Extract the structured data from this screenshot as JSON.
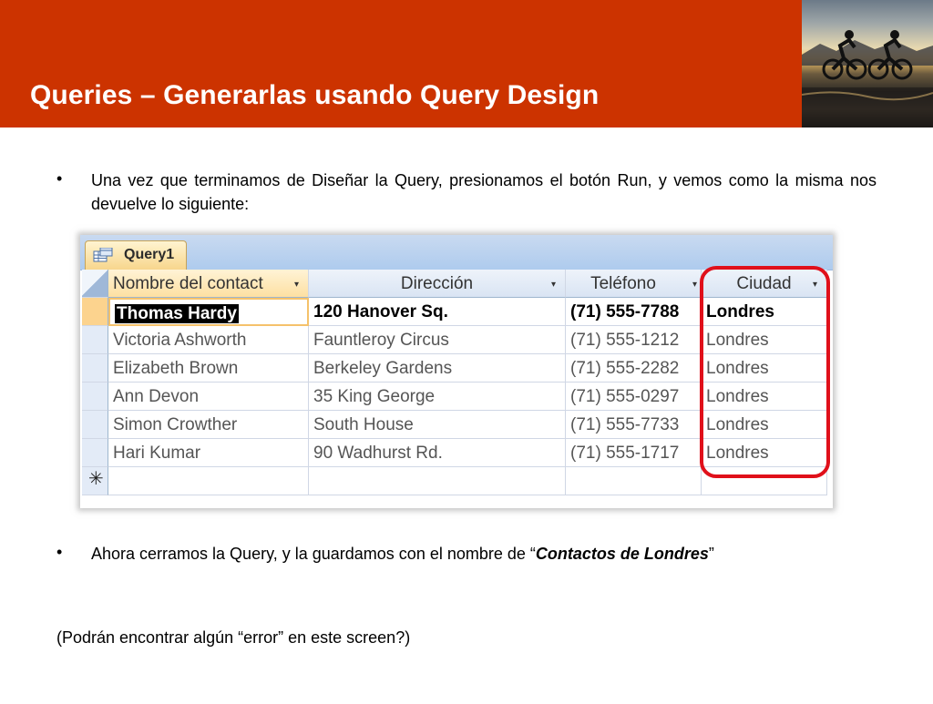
{
  "slide": {
    "title": "Queries – Generarlas usando Query Design",
    "bullet_symbol": "•",
    "bullet1": "Una vez que terminamos de Diseñar la Query, presionamos el botón Run, y vemos como la misma nos devuelve lo siguiente:",
    "bullet2_pre": "Ahora cerramos la Query, y la guardamos con el nombre de “",
    "bullet2_em": "Contactos de Londres",
    "bullet2_post": "”",
    "note": "(Podrán encontrar algún “error” en este screen?)"
  },
  "datasheet": {
    "tab_label": "Query1",
    "columns": [
      "Nombre del contact",
      "Dirección",
      "Teléfono",
      "Ciudad"
    ],
    "rows": [
      [
        "Thomas Hardy",
        "120 Hanover Sq.",
        "(71) 555-7788",
        "Londres"
      ],
      [
        "Victoria Ashworth",
        "Fauntleroy Circus",
        "(71) 555-1212",
        "Londres"
      ],
      [
        "Elizabeth Brown",
        "Berkeley Gardens",
        "(71) 555-2282",
        "Londres"
      ],
      [
        "Ann Devon",
        "35 King George",
        "(71) 555-0297",
        "Londres"
      ],
      [
        "Simon Crowther",
        "South House",
        "(71) 555-7733",
        "Londres"
      ],
      [
        "Hari Kumar",
        "90 Wadhurst Rd.",
        "(71) 555-1717",
        "Londres"
      ]
    ],
    "new_row_symbol": "✳",
    "dropdown_glyph": "▾"
  },
  "colors": {
    "header_bg": "#cc3300",
    "highlight_circle": "#e0101a"
  }
}
